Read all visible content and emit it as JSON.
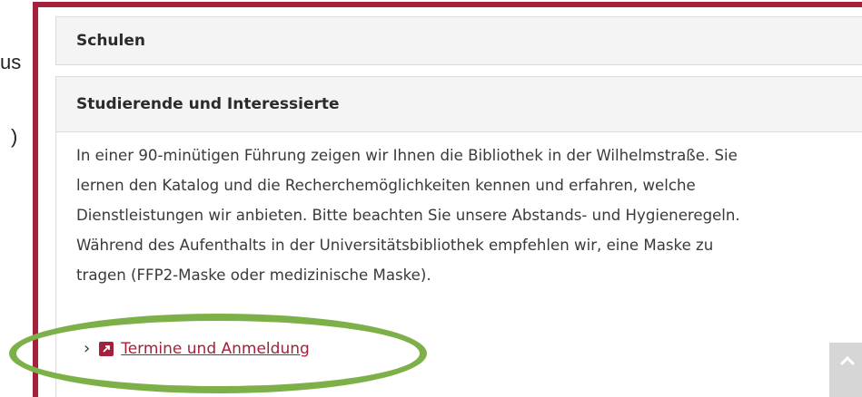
{
  "outside": {
    "fragment1": "us",
    "fragment2": ")"
  },
  "accordion": {
    "item1": {
      "title": "Schulen"
    },
    "item2": {
      "title": "Studierende und Interessierte",
      "lines": [
        "In einer 90-minütigen Führung zeigen wir Ihnen die Bibliothek in der Wilhelmstraße. Sie",
        "lernen den Katalog und die Recherchemöglichkeiten kennen und erfahren, welche",
        "Dienstleistungen wir anbieten. Bitte beachten Sie unsere Abstands- und Hygieneregeln.",
        "Während des Aufenthalts in der Universitätsbibliothek empfehlen wir, eine Maske zu",
        "tragen (FFP2-Maske oder medizinische Maske)."
      ],
      "link_label": "Termine und Anmeldung"
    }
  },
  "icons": {
    "chevron": "chevron-right-icon",
    "external": "external-link-icon",
    "scroll": "back-to-top-icon"
  },
  "colors": {
    "accent": "#a3213a",
    "highlight": "#7eb04a",
    "header_bg": "#f4f4f4"
  }
}
